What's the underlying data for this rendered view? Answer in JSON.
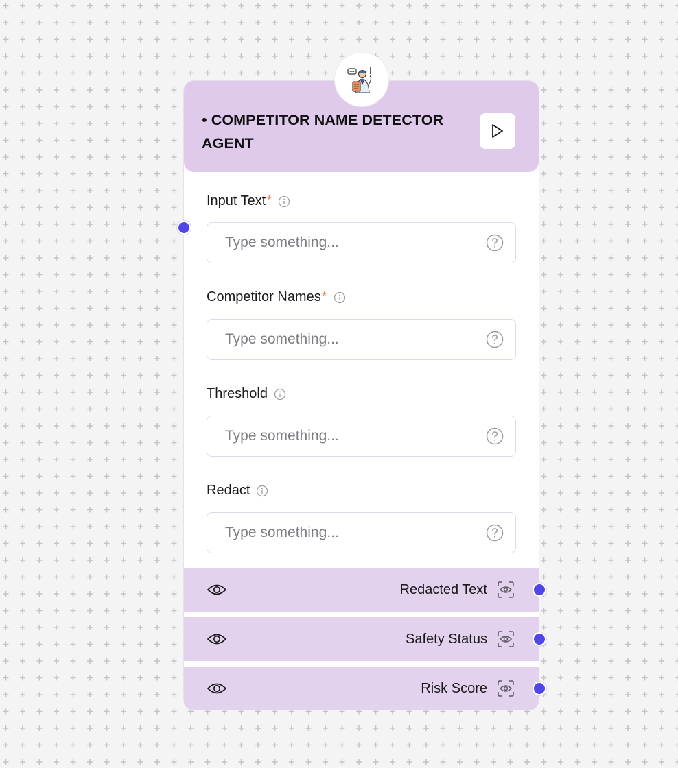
{
  "node": {
    "title": "• COMPETITOR NAME DETECTOR AGENT",
    "avatar_icon": "agent-avatar-icon",
    "run_icon": "play-icon"
  },
  "fields": [
    {
      "label": "Input Text",
      "required": true,
      "required_mark": "*",
      "placeholder": "Type something...",
      "value": ""
    },
    {
      "label": "Competitor Names",
      "required": true,
      "required_mark": "*",
      "placeholder": "Type something...",
      "value": ""
    },
    {
      "label": "Threshold",
      "required": false,
      "placeholder": "Type something...",
      "value": ""
    },
    {
      "label": "Redact",
      "required": false,
      "placeholder": "Type something...",
      "value": ""
    }
  ],
  "outputs": [
    {
      "label": "Redacted Text"
    },
    {
      "label": "Safety Status"
    },
    {
      "label": "Risk Score"
    }
  ],
  "colors": {
    "header_bg": "#dfcaec",
    "output_bg": "#e3d2ee",
    "handle": "#4f46e5",
    "required": "#ee8a5a",
    "canvas_bg": "#f4f4f5",
    "grid_plus": "#c4c4c8"
  }
}
